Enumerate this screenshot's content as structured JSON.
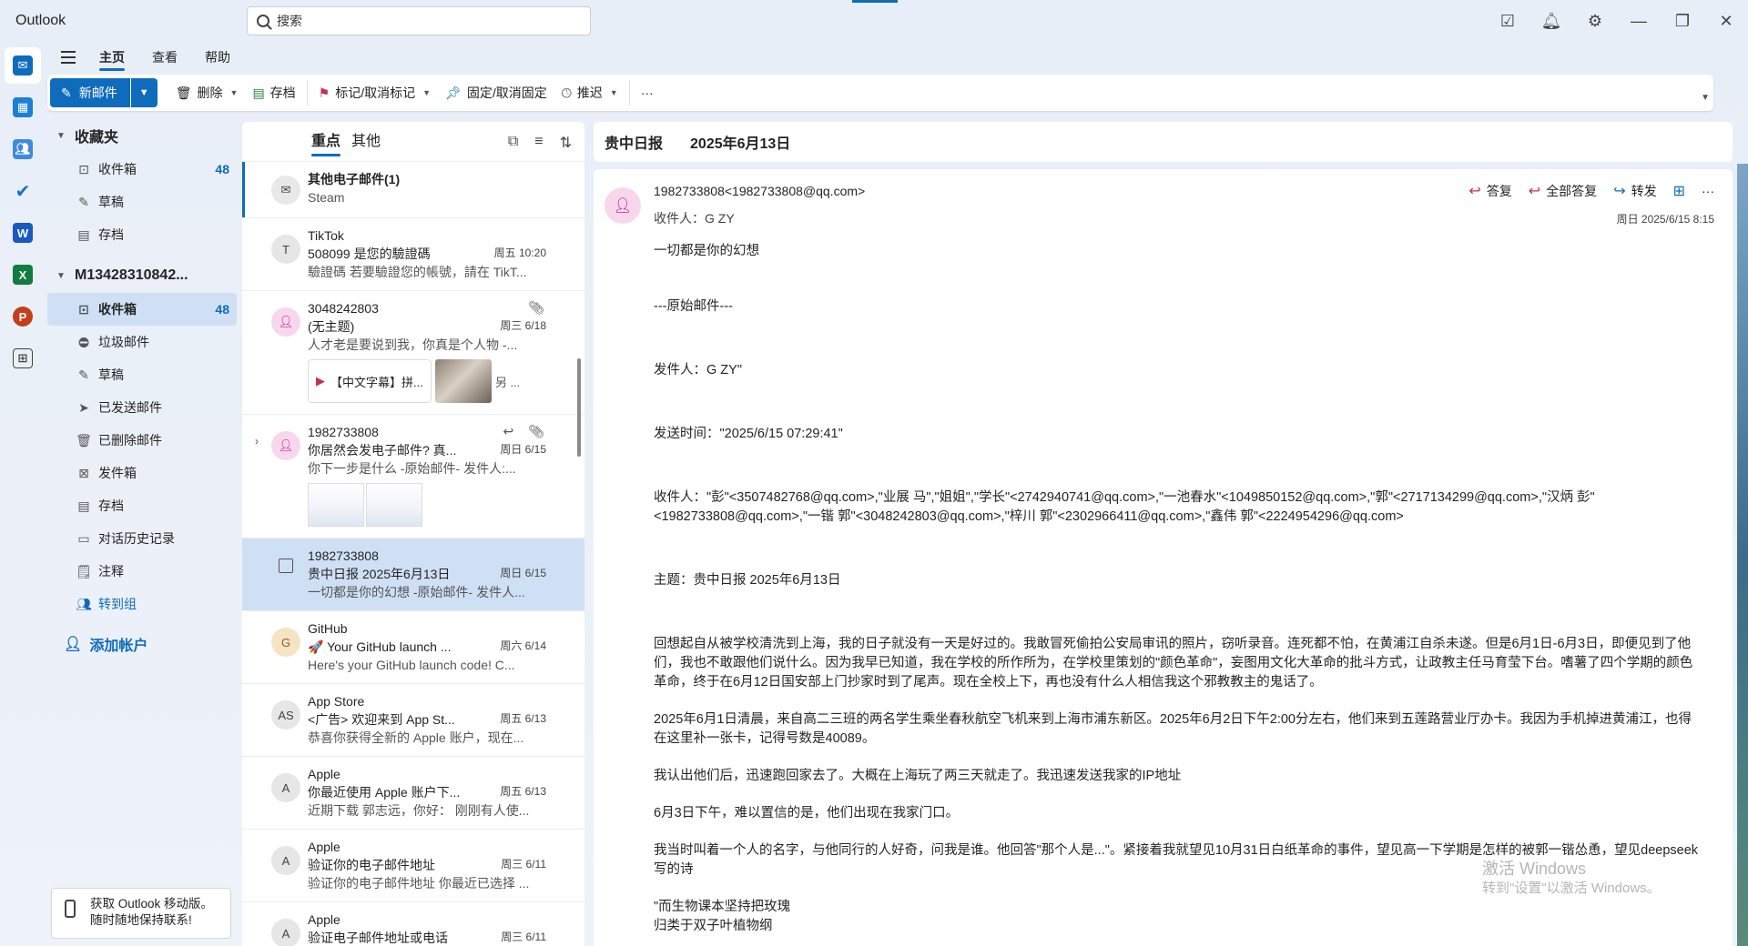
{
  "app": {
    "title": "Outlook"
  },
  "search": {
    "placeholder": "搜索"
  },
  "menu": {
    "tabs": [
      "主页",
      "查看",
      "帮助"
    ]
  },
  "ribbon": {
    "new_mail": "新邮件",
    "delete": "删除",
    "archive": "存档",
    "flag": "标记/取消标记",
    "pin": "固定/取消固定",
    "snooze": "推迟",
    "more": "···"
  },
  "folders": {
    "favorites_title": "收藏夹",
    "favorites": [
      {
        "label": "收件箱",
        "count": "48"
      },
      {
        "label": "草稿",
        "count": ""
      },
      {
        "label": "存档",
        "count": ""
      }
    ],
    "account_title": "M13428310842...",
    "account_items": [
      {
        "label": "收件箱",
        "count": "48"
      },
      {
        "label": "垃圾邮件",
        "count": ""
      },
      {
        "label": "草稿",
        "count": ""
      },
      {
        "label": "已发送邮件",
        "count": ""
      },
      {
        "label": "已删除邮件",
        "count": ""
      },
      {
        "label": "发件箱",
        "count": ""
      },
      {
        "label": "存档",
        "count": ""
      },
      {
        "label": "对话历史记录",
        "count": ""
      },
      {
        "label": "注释",
        "count": ""
      },
      {
        "label": "转到组",
        "count": ""
      }
    ],
    "add_account": "添加帐户",
    "promo": "获取 Outlook 移动版。随时随地保持联系!"
  },
  "list": {
    "tabs": [
      "重点",
      "其他"
    ],
    "items": [
      {
        "sender": "其他电子邮件(1)",
        "subject": "Steam",
        "preview": "",
        "date": "",
        "avatar": ""
      },
      {
        "sender": "TikTok",
        "subject": "508099 是您的驗證碼",
        "preview": "驗證碼 若要驗證您的帳號，請在 TikT...",
        "date": "周五 10:20",
        "avatar": "T"
      },
      {
        "sender": "3048242803",
        "subject": "(无主题)",
        "preview": "人才老是要说到我，你真是个人物 -...",
        "date": "周三 6/18",
        "avatar": "",
        "attachment": "【中文字幕】拼...",
        "more": "另 ..."
      },
      {
        "sender": "1982733808",
        "subject": "你居然会发电子邮件? 真...",
        "preview": "你下一步是什么 -原始邮件- 发件人:...",
        "date": "周日 6/15",
        "avatar": ""
      },
      {
        "sender": "1982733808",
        "subject": "贵中日报 2025年6月13日",
        "preview": "一切都是你的幻想 -原始邮件- 发件人...",
        "date": "周日 6/15",
        "avatar": ""
      },
      {
        "sender": "GitHub",
        "subject": "🚀 Your GitHub launch ...",
        "preview": "Here's your GitHub launch code! C...",
        "date": "周六 6/14",
        "avatar": "G"
      },
      {
        "sender": "App Store",
        "subject": "<广告> 欢迎来到 App St...",
        "preview": "恭喜你获得全新的 Apple 账户，现在...",
        "date": "周五 6/13",
        "avatar": "AS"
      },
      {
        "sender": "Apple",
        "subject": "你最近使用 Apple 账户下...",
        "preview": "近期下载 郭志远，你好：   刚刚有人使...",
        "date": "周五 6/13",
        "avatar": "A"
      },
      {
        "sender": "Apple",
        "subject": "验证你的电子邮件地址",
        "preview": "验证你的电子邮件地址 你最近已选择 ...",
        "date": "周三 6/11",
        "avatar": "A"
      },
      {
        "sender": "Apple",
        "subject": "验证电子邮件地址或电话",
        "preview": "",
        "date": "周三 6/11",
        "avatar": "A"
      }
    ]
  },
  "reading": {
    "header_title": "贵中日报",
    "header_date": "2025年6月13日",
    "from": "1982733808<1982733808@qq.com>",
    "to": "收件人：G ZY",
    "date": "周日 2025/6/15 8:15",
    "actions": {
      "reply": "答复",
      "reply_all": "全部答复",
      "forward": "转发"
    },
    "body": {
      "line1": "一切都是你的幻想",
      "line2": "---原始邮件---",
      "line3": "发件人：G ZY\"",
      "line4": "发送时间：\"2025/6/15 07:29:41\"",
      "line5": "收件人：\"彭\"<3507482768@qq.com>,\"业展 马\",\"姐姐\",\"学长\"<2742940741@qq.com>,\"一池春水\"<1049850152@qq.com>,\"郭\"<2717134299@qq.com>,\"汉炳 彭\"<1982733808@qq.com>,\"一锴 郭\"<3048242803@qq.com>,\"梓川 郭\"<2302966411@qq.com>,\"鑫伟 郭\"<2224954296@qq.com>",
      "line6": "主题：贵中日报 2025年6月13日",
      "p1": "回想起自从被学校清洗到上海，我的日子就没有一天是好过的。我敢冒死偷拍公安局审讯的照片，窃听录音。连死都不怕，在黄浦江自杀未遂。但是6月1日-6月3日，即便见到了他们，我也不敢跟他们说什么。因为我早已知道，我在学校的所作所为，在学校里策划的\"颜色革命\"，妄图用文化大革命的批斗方式，让政教主任马育莹下台。嗜薯了四个学期的颜色革命，终于在6月12日国安部上门抄家时到了尾声。现在全校上下，再也没有什么人相信我这个邪教教主的鬼话了。",
      "p2": "2025年6月1日清晨，来自高二三班的两名学生乘坐春秋航空飞机来到上海市浦东新区。2025年6月2日下午2:00分左右，他们来到五莲路营业厅办卡。我因为手机掉进黄浦江，也得在这里补一张卡，记得号数是40089。",
      "p3": "我认出他们后，迅速跑回家去了。大概在上海玩了两三天就走了。我迅速发送我家的IP地址",
      "p4": "6月3日下午，难以置信的是，他们出现在我家门口。",
      "p5": "我当时叫着一个人的名字，与他同行的人好奇，问我是谁。他回答\"那个人是...\"。紧接着我就望见10月31日白纸革命的事件，望见高一下学期是怎样的被郭一锴怂恿，望见deepseek写的诗",
      "p6": "\"而生物课本坚持把玫瑰",
      "p7": "归类于双子叶植物纲"
    }
  },
  "watermark": {
    "line1": "激活 Windows",
    "line2": "转到\"设置\"以激活 Windows。"
  },
  "colors": {
    "accent": "#0f6cbd",
    "selected": "#cfe0f5"
  }
}
